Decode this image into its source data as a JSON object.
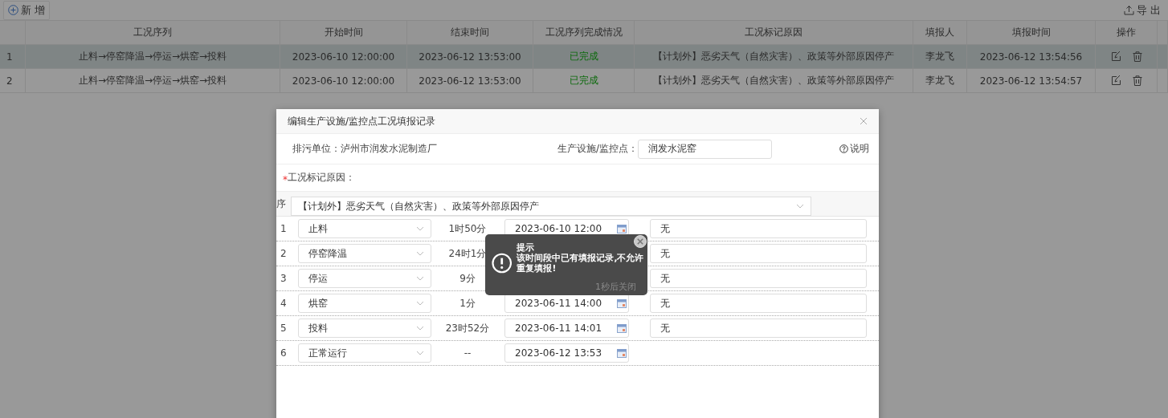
{
  "toolbar": {
    "add_button": "新 增",
    "export_button": "导 出"
  },
  "table": {
    "columns": [
      "工况序列",
      "开始时间",
      "结束时间",
      "工况序列完成情况",
      "工况标记原因",
      "填报人",
      "填报时间",
      "操作"
    ],
    "rows": [
      {
        "index": "1",
        "sequence": "止料→停窑降温→停运→烘窑→投料",
        "start": "2023-06-10 12:00:00",
        "end": "2023-06-12 13:53:00",
        "status": "已完成",
        "reason": "【计划外】恶劣天气（自然灾害）、政策等外部原因停产",
        "reporter": "李龙飞",
        "report_time": "2023-06-12 13:54:56",
        "selected": true
      },
      {
        "index": "2",
        "sequence": "止料→停窑降温→停运→烘窑→投料",
        "start": "2023-06-10 12:00:00",
        "end": "2023-06-12 13:53:00",
        "status": "已完成",
        "reason": "【计划外】恶劣天气（自然灾害）、政策等外部原因停产",
        "reporter": "李龙飞",
        "report_time": "2023-06-12 13:54:57",
        "selected": false
      }
    ]
  },
  "dialog": {
    "title": "编辑生产设施/监控点工况填报记录",
    "unit": "排污单位：泸州市润发水泥制造厂",
    "facility_label": "生产设施/监控点：",
    "facility_value": "润发水泥窑",
    "help": "说明",
    "required_mark": "*",
    "reason_label": "工况标记原因：",
    "reason_select": "【计划外】恶劣天气（自然灾害）、政策等外部原因停产",
    "index_header": "序",
    "rows": [
      {
        "index": "1",
        "condition": "止料",
        "duration": "1时50分",
        "time": "2023-06-10 12:00",
        "remark": "无"
      },
      {
        "index": "2",
        "condition": "停窑降温",
        "duration": "24时1分",
        "remark": "无"
      },
      {
        "index": "3",
        "condition": "停运",
        "duration": "9分",
        "remark": "无"
      },
      {
        "index": "4",
        "condition": "烘窑",
        "duration": "1分",
        "time": "2023-06-11 14:00",
        "remark": "无"
      },
      {
        "index": "5",
        "condition": "投料",
        "duration": "23时52分",
        "time": "2023-06-11 14:01",
        "remark": "无"
      },
      {
        "index": "6",
        "condition": "正常运行",
        "duration": "--",
        "time": "2023-06-12 13:53"
      }
    ]
  },
  "toast": {
    "title": "提示",
    "message": "该时间段中已有填报记录,不允许重复填报!",
    "countdown": "1秒后关闭"
  }
}
